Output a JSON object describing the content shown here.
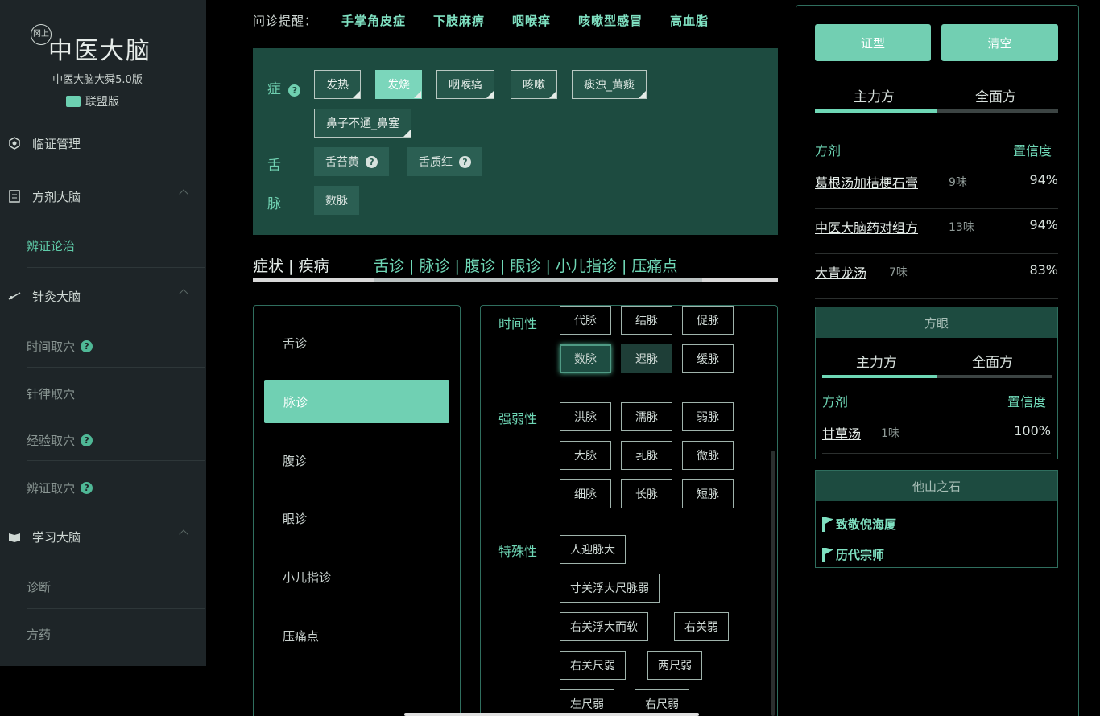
{
  "sidebar": {
    "logo_mark": "冈上",
    "logo_title": "中医大脑",
    "version": "中医大脑大舜5.0版",
    "edition": "联盟版",
    "items": [
      {
        "label": "临证管理"
      },
      {
        "label": "方剂大脑"
      },
      {
        "label": "辨证论治"
      },
      {
        "label": "针灸大脑"
      },
      {
        "label": "时间取穴"
      },
      {
        "label": "针律取穴"
      },
      {
        "label": "经验取穴"
      },
      {
        "label": "辨证取穴"
      },
      {
        "label": "学习大脑"
      },
      {
        "label": "诊断"
      },
      {
        "label": "方药"
      }
    ]
  },
  "reminder": {
    "label": "问诊提醒：",
    "items": [
      "手掌角皮症",
      "下肢麻痹",
      "咽喉痒",
      "咳嗽型感冒",
      "高血脂"
    ]
  },
  "symptoms": {
    "zheng_label": "症",
    "tongue_label": "舌",
    "pulse_label": "脉",
    "zheng_chips": [
      "发热",
      "发烧",
      "咽喉痛",
      "咳嗽",
      "痰浊_黄痰",
      "鼻子不通_鼻塞"
    ],
    "tongue_chips": [
      "舌苔黄",
      "舌质红"
    ],
    "pulse_chips": [
      "数脉"
    ]
  },
  "tabs": {
    "left": "症状 | 疾病",
    "right": "舌诊 | 脉诊 | 腹诊 | 眼诊 | 小儿指诊 | 压痛点"
  },
  "diag_list": [
    "舌诊",
    "脉诊",
    "腹诊",
    "眼诊",
    "小儿指诊",
    "压痛点"
  ],
  "pulse": {
    "groups": [
      "时间性",
      "强弱性",
      "特殊性"
    ],
    "time": [
      "代脉",
      "结脉",
      "促脉",
      "数脉",
      "迟脉",
      "缓脉"
    ],
    "strength": [
      "洪脉",
      "濡脉",
      "弱脉",
      "大脉",
      "芤脉",
      "微脉",
      "细脉",
      "长脉",
      "短脉"
    ],
    "special": [
      "人迎脉大",
      "寸关浮大尺脉弱",
      "右关浮大而软",
      "右关弱",
      "右关尺弱",
      "两尺弱",
      "左尺弱",
      "右尺弱"
    ]
  },
  "right": {
    "btn_syndrome": "证型",
    "btn_clear": "清空",
    "tab_main": "主力方",
    "tab_full": "全面方",
    "col_formula": "方剂",
    "col_conf": "置信度",
    "rows": [
      {
        "name": "葛根汤加桔梗石膏",
        "count": "9味",
        "pct": "94%"
      },
      {
        "name": "中医大脑药对组方",
        "count": "13味",
        "pct": "94%"
      },
      {
        "name": "大青龙汤",
        "count": "7味",
        "pct": "83%"
      }
    ],
    "fangyan": {
      "title": "方眼",
      "tab_main": "主力方",
      "tab_full": "全面方",
      "col_formula": "方剂",
      "col_conf": "置信度",
      "row": {
        "name": "甘草汤",
        "count": "1味",
        "pct": "100%"
      }
    },
    "tashan": {
      "title": "他山之石",
      "links": [
        "致敬倪海厦",
        "历代宗师"
      ]
    }
  },
  "colors": {
    "accent": "#6fd7b6",
    "panel": "#1d4b40",
    "sidebar": "#1e2528"
  }
}
